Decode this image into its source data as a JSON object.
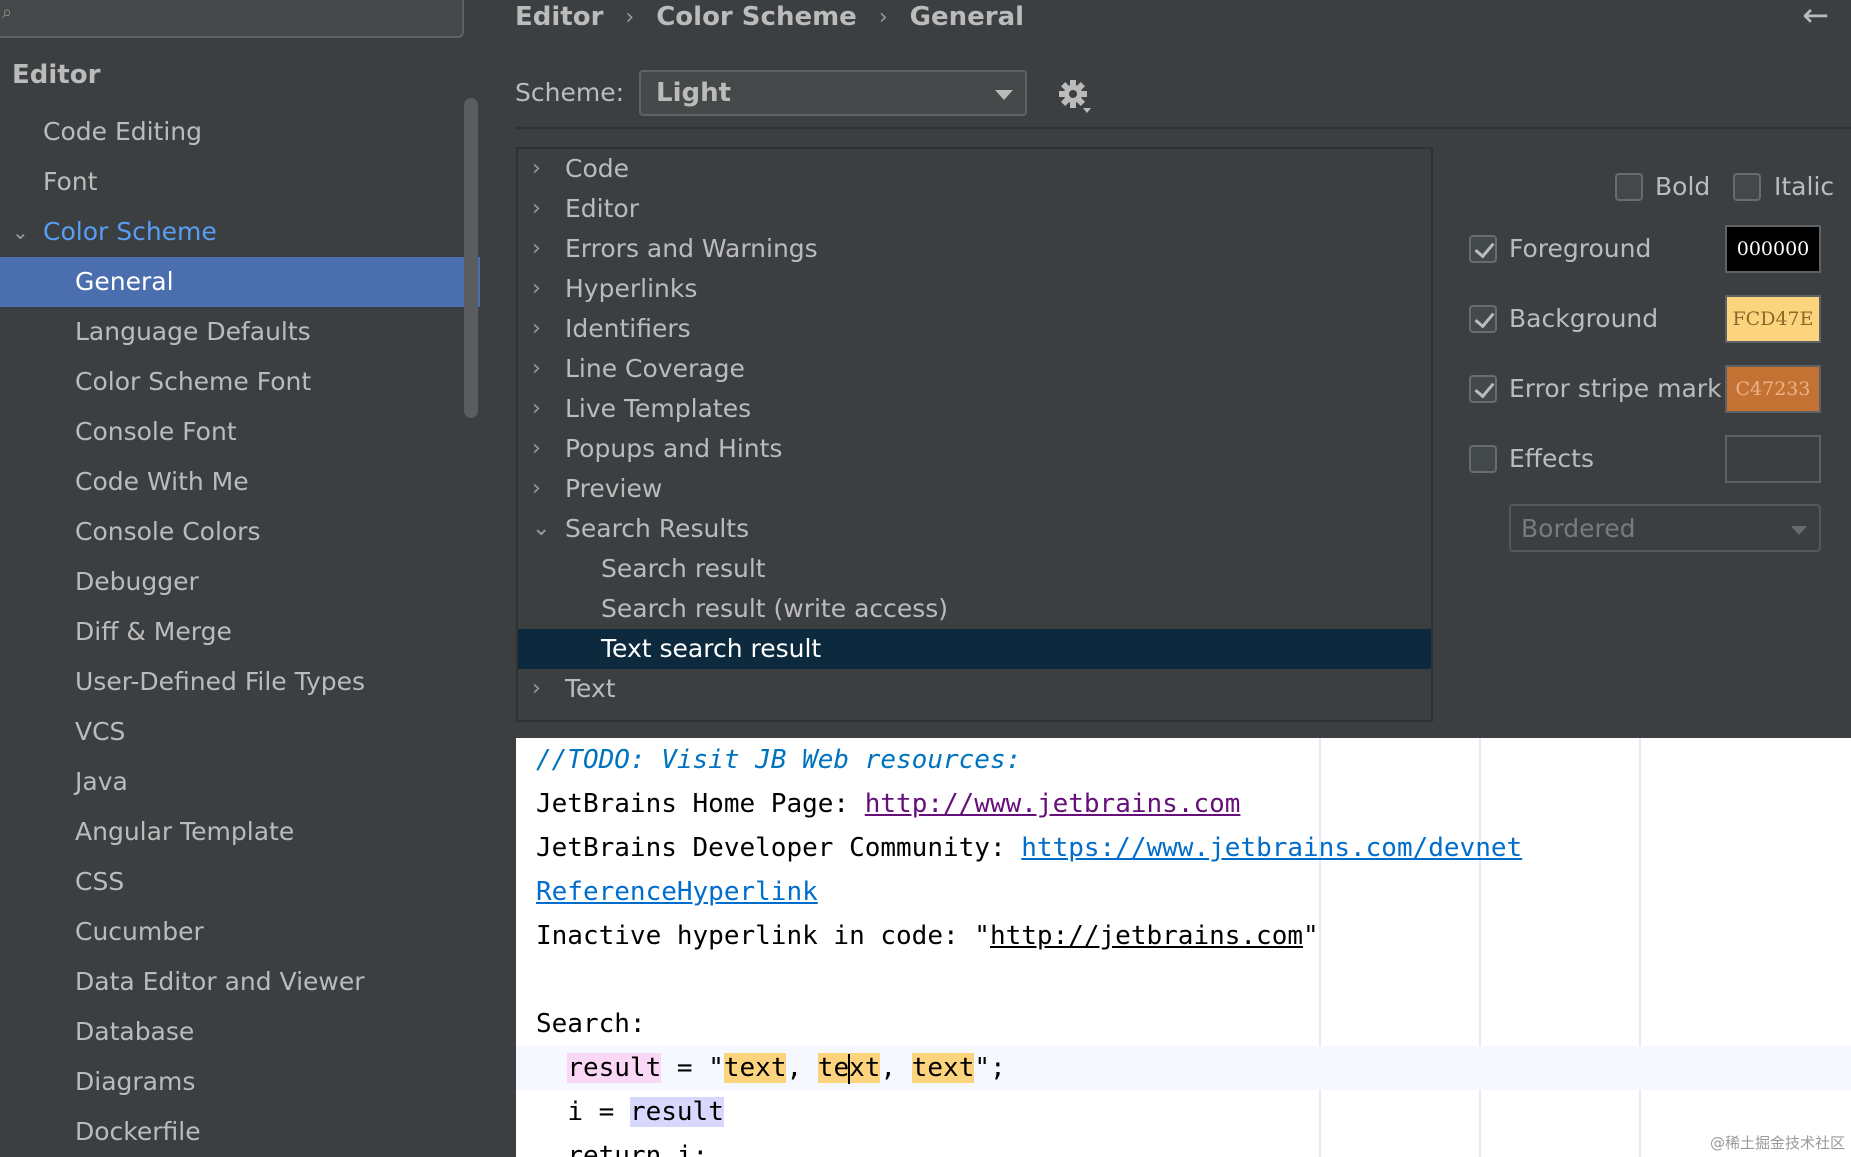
{
  "sidebar": {
    "header": "Editor",
    "items": [
      {
        "label": "Code Editing"
      },
      {
        "label": "Font"
      },
      {
        "label": "Color Scheme"
      },
      {
        "label": "General"
      },
      {
        "label": "Language Defaults"
      },
      {
        "label": "Color Scheme Font"
      },
      {
        "label": "Console Font"
      },
      {
        "label": "Code With Me"
      },
      {
        "label": "Console Colors"
      },
      {
        "label": "Debugger"
      },
      {
        "label": "Diff & Merge"
      },
      {
        "label": "User-Defined File Types"
      },
      {
        "label": "VCS"
      },
      {
        "label": "Java"
      },
      {
        "label": "Angular Template"
      },
      {
        "label": "CSS"
      },
      {
        "label": "Cucumber"
      },
      {
        "label": "Data Editor and Viewer"
      },
      {
        "label": "Database"
      },
      {
        "label": "Diagrams"
      },
      {
        "label": "Dockerfile"
      }
    ]
  },
  "breadcrumb": [
    "Editor",
    "Color Scheme",
    "General"
  ],
  "scheme": {
    "label": "Scheme:",
    "value": "Light"
  },
  "tree": {
    "rows": [
      {
        "label": "Code"
      },
      {
        "label": "Editor"
      },
      {
        "label": "Errors and Warnings"
      },
      {
        "label": "Hyperlinks"
      },
      {
        "label": "Identifiers"
      },
      {
        "label": "Line Coverage"
      },
      {
        "label": "Live Templates"
      },
      {
        "label": "Popups and Hints"
      },
      {
        "label": "Preview"
      },
      {
        "label": "Search Results"
      },
      {
        "label": "Search result"
      },
      {
        "label": "Search result (write access)"
      },
      {
        "label": "Text search result"
      },
      {
        "label": "Text"
      }
    ]
  },
  "attributes": {
    "bold": {
      "label": "Bold",
      "checked": false
    },
    "italic": {
      "label": "Italic",
      "checked": false
    },
    "foreground": {
      "label": "Foreground",
      "checked": true,
      "value": "000000",
      "color": "#000000"
    },
    "background": {
      "label": "Background",
      "checked": true,
      "value": "FCD47E",
      "color": "#FCD47E"
    },
    "error_stripe": {
      "label": "Error stripe mark",
      "checked": true,
      "value": "C47233",
      "color": "#C47233"
    },
    "effects": {
      "label": "Effects",
      "checked": false,
      "value": ""
    },
    "effect_type": "Bordered"
  },
  "preview": {
    "todo": "//TODO: Visit JB Web resources:",
    "home_label": "JetBrains Home Page: ",
    "home_url": "http://www.jetbrains.com",
    "dev_label": "JetBrains Developer Community: ",
    "dev_url": "https://www.jetbrains.com/devnet",
    "ref_link": "ReferenceHyperlink",
    "inactive_label": "Inactive hyperlink in code: \"",
    "inactive_url": "http://jetbrains.com",
    "inactive_end": "\"",
    "search_label": "Search:",
    "line1_var": "result",
    "line1_eq": " = \"",
    "text1": "text",
    "comma1": ", ",
    "text2a": "te",
    "text2b": "xt",
    "comma2": ", ",
    "text3": "text",
    "line1_end": "\";",
    "line2_var": "i",
    "line2_eq": " = ",
    "line2_val": "result",
    "line3": "return i;"
  },
  "watermark": "@稀土掘金技术社区"
}
